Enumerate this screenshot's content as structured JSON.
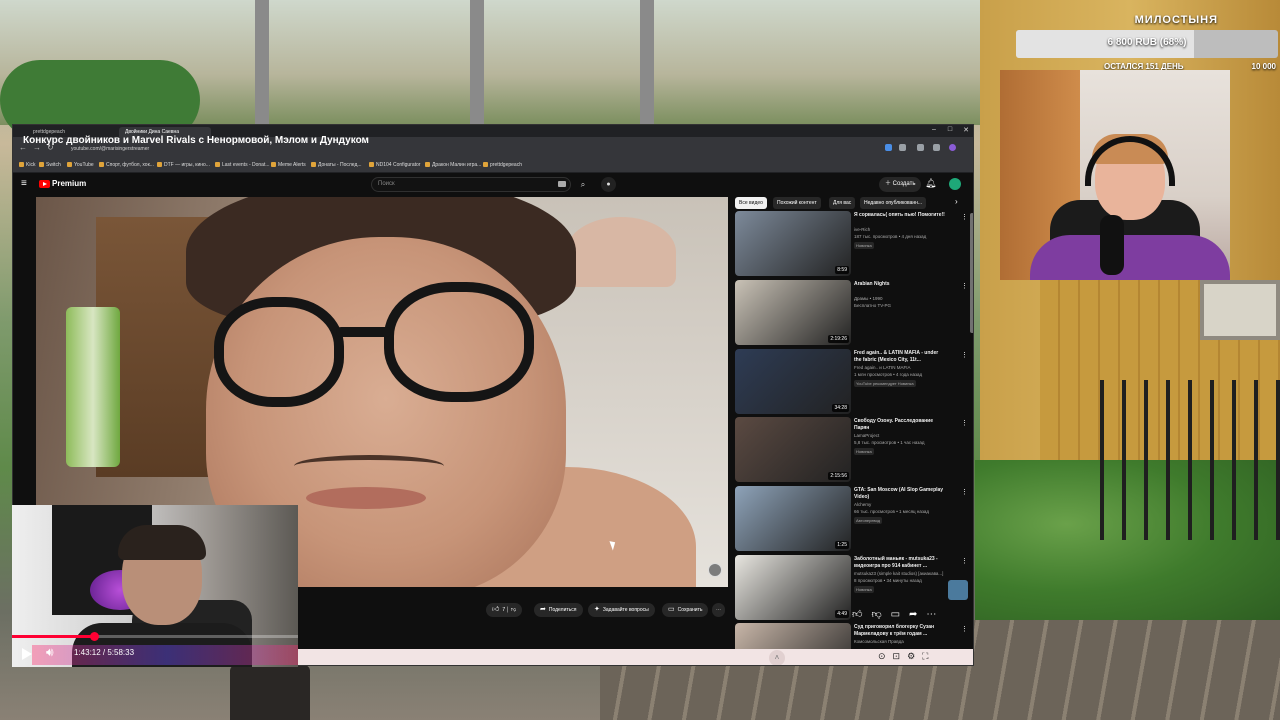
{
  "overlay": {
    "donation": {
      "title": "МИЛОСТЫНЯ",
      "amount": "6 800 RUB (68%)",
      "progress": 0.68,
      "time_left": "ОСТАЛСЯ 151 ДЕНЬ",
      "goal": "10 000"
    }
  },
  "browser": {
    "tabs": [
      {
        "label": "prettdgepeach",
        "active": false
      },
      {
        "label": "Двойники Дина Саевна",
        "active": true
      }
    ],
    "window_controls": [
      "–",
      "□",
      "✕"
    ],
    "page_title": "Конкурс двойников и Marvel Rivals с Ненормовой, Мэлом и Дундуком",
    "url": "youtube.com/@marisingerstreamer",
    "bookmarks": [
      "Kick",
      "Switch",
      "YouTube",
      "Спорт, футбол, хок...",
      "DTF — игры, кино...",
      "Last events - Donat...",
      "Meme Alerts",
      "Донаты - Послед...",
      "ND104 Configurator",
      "Дракон Малин игра...",
      "prettdgepeach"
    ]
  },
  "youtube": {
    "brand": "Premium",
    "search_placeholder": "Поиск",
    "create_label": "Создать",
    "chips": [
      {
        "label": "Все видео",
        "active": true
      },
      {
        "label": "Похожий контент",
        "active": false
      },
      {
        "label": "Для вас",
        "active": false
      },
      {
        "label": "Недавно опубликованн...",
        "active": false
      }
    ],
    "actions": {
      "likes": "7",
      "share": "Поделиться",
      "ask": "Задавайте вопросы",
      "save": "Сохранить"
    },
    "recommendations": [
      {
        "title": "Я сорвалась( опять пью! Помогите!!",
        "channel": "ive-Rich",
        "meta": "187 тыс. просмотров • 4 дня назад",
        "badge": "Новинка",
        "duration": "8:59",
        "color": "#7d8a9a"
      },
      {
        "title": "Arabian Nights",
        "channel": "Драмы • 1990",
        "meta": "Бесплатно   TV-PG",
        "badge": "",
        "duration": "2:19:26",
        "color": "#c9c2b6"
      },
      {
        "title": "Fred again.. & LATIN MAFIA - under the fabric (Mexico City, 11t...",
        "channel": "Fred again.. и LATIN MAFIA",
        "meta": "1 млн просмотров • 4 года назад",
        "badge": "YouTube рекомендует   Новинка",
        "duration": "34:28",
        "color": "#2e3c55"
      },
      {
        "title": "Свободу Озону. Расследование Парян",
        "channel": "LamaProject",
        "meta": "5,8 тыс. просмотров • 1 час назад",
        "badge": "Новинка",
        "duration": "2:15:56",
        "color": "#5b4a42"
      },
      {
        "title": "GTA: San Moscow (AI Slop Gameplay Video)",
        "channel": "Alchemy",
        "meta": "66 тыс. просмотров • 1 месяц назад",
        "badge": "Автоперевод",
        "duration": "1:25",
        "color": "#8ea3b9"
      },
      {
        "title": "Заболотный маньяк - mutsuka23 - видеоигра про 914 кабинет ...",
        "channel": "mutsuka23 (simple kait studios) [акиакава...]",
        "meta": "8 просмотров • 34 минуты назад",
        "badge": "Новинка",
        "duration": "4:49",
        "color": "#e8e6e0"
      },
      {
        "title": "Суд приговорил блогерку Сузан Мармеладову к трём годам ...",
        "channel": "Комсомольская Правда",
        "meta": "",
        "badge": "",
        "duration": "",
        "color": "#c8b6a8"
      }
    ]
  },
  "player": {
    "time": "1:43:12 / 5:58:33",
    "progress": 0.287
  }
}
